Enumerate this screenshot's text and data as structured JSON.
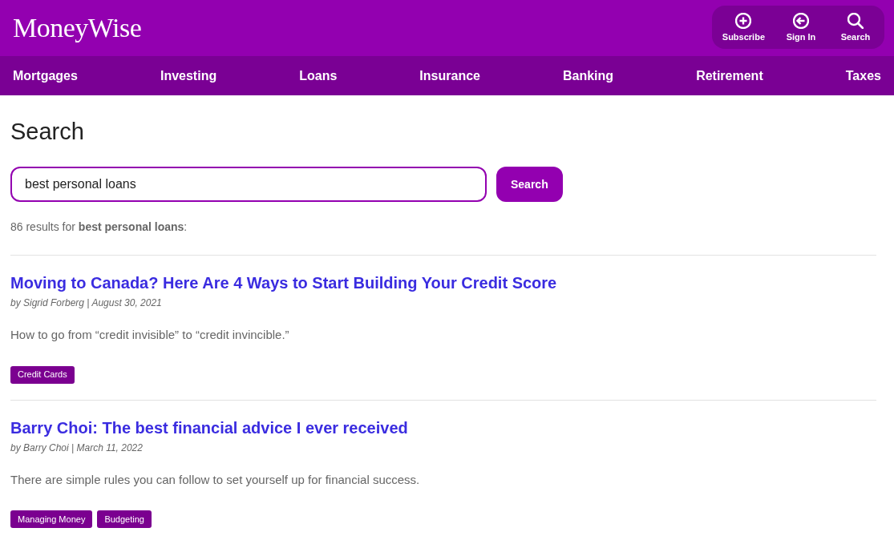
{
  "header": {
    "logo": "MoneyWise",
    "actions": [
      {
        "label": "Subscribe"
      },
      {
        "label": "Sign In"
      },
      {
        "label": "Search"
      }
    ]
  },
  "nav": {
    "items": [
      "Mortgages",
      "Investing",
      "Loans",
      "Insurance",
      "Banking",
      "Retirement",
      "Taxes"
    ]
  },
  "search": {
    "heading": "Search",
    "value": "best personal loans",
    "button": "Search",
    "summary": "86 results for **best personal loans**:"
  },
  "results": [
    {
      "title": "Moving to Canada? Here Are 4 Ways to Start Building Your Credit Score",
      "meta": "by Sigrid Forberg | August 30, 2021",
      "excerpt": "How to go from “credit invisible” to “credit invincible.”",
      "tags": [
        "Credit Cards"
      ]
    },
    {
      "title": "Barry Choi: The best financial advice I ever received",
      "meta": "by Barry Choi | March 11, 2022",
      "excerpt": "There are simple rules you can follow to set yourself up for financial success.",
      "tags": [
        "Managing Money",
        "Budgeting"
      ]
    }
  ]
}
